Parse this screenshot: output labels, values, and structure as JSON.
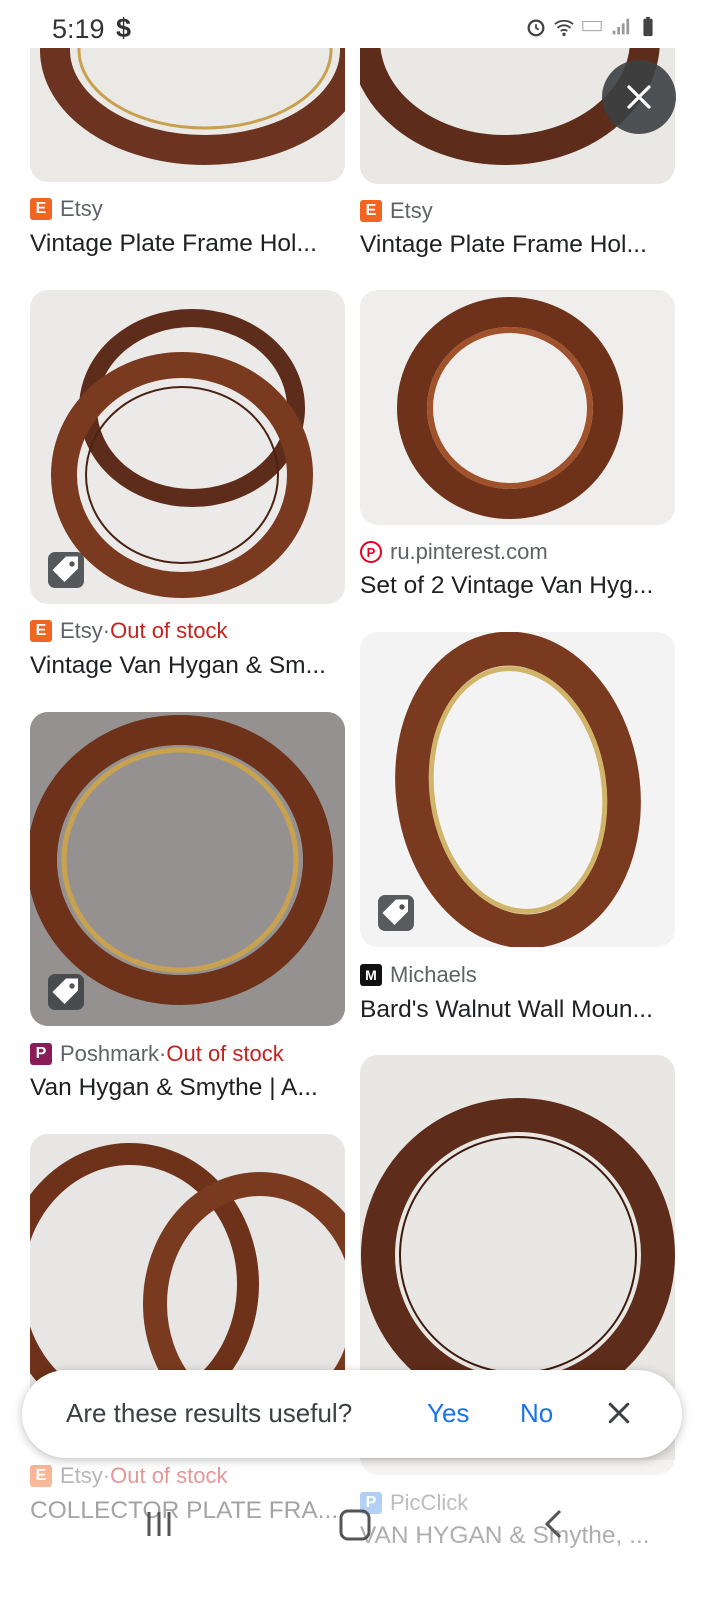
{
  "status": {
    "time": "5:19",
    "extra": "$"
  },
  "icons": {
    "close_overlay": "close-icon",
    "tag": "price-tag-icon"
  },
  "colors": {
    "accent": "#1a73e8",
    "out_of_stock": "#c5221f",
    "frame_brown": "#6b3320"
  },
  "results": [
    {
      "source": "Etsy",
      "title": "Vintage Plate Frame Hol...",
      "out_of_stock": ""
    },
    {
      "source": "Etsy",
      "title": "Vintage Plate Frame Hol...",
      "out_of_stock": ""
    },
    {
      "source": "Etsy",
      "title": "Vintage Van Hygan & Sm...",
      "out_of_stock": "Out of stock"
    },
    {
      "source": "ru.pinterest.com",
      "title": "Set of 2 Vintage Van Hyg...",
      "out_of_stock": ""
    },
    {
      "source": "Michaels",
      "title": "Bard's Walnut Wall Moun...",
      "out_of_stock": ""
    },
    {
      "source": "Poshmark",
      "title": "Van Hygan & Smythe | A...",
      "out_of_stock": "Out of stock"
    },
    {
      "source": "Etsy",
      "title": "COLLECTOR PLATE FRA...",
      "out_of_stock": "Out of stock"
    },
    {
      "source": "PicClick",
      "title": "VAN HYGAN & Smythe, ...",
      "out_of_stock": ""
    }
  ],
  "feedback": {
    "question": "Are these results useful?",
    "yes": "Yes",
    "no": "No"
  },
  "separator": " · "
}
